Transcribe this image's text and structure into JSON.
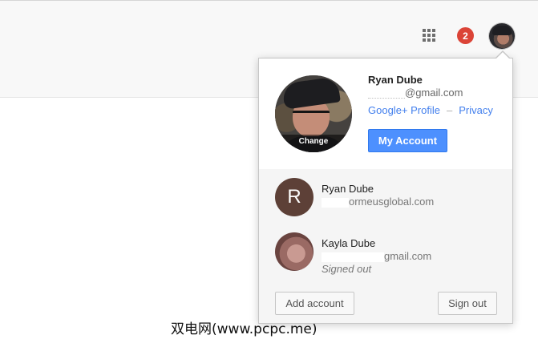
{
  "header": {
    "apps_icon": "apps-grid-icon",
    "notification_count": "2",
    "notification_color": "#db4437"
  },
  "account_menu": {
    "primary": {
      "name": "Ryan Dube",
      "email_suffix": "@gmail.com",
      "change_label": "Change",
      "profile_link": "Google+ Profile",
      "separator": "–",
      "privacy_link": "Privacy",
      "my_account_button": "My Account"
    },
    "accounts": [
      {
        "initial": "R",
        "name": "Ryan Dube",
        "email_suffix": "ormeusglobal.com",
        "status": ""
      },
      {
        "initial": "",
        "name": "Kayla Dube",
        "email_suffix": "gmail.com",
        "status": "Signed out"
      }
    ],
    "footer": {
      "add_account": "Add account",
      "sign_out": "Sign out"
    }
  },
  "colors": {
    "link": "#427fed",
    "primary_button": "#4d90fe",
    "letter_avatar": "#5d4037"
  },
  "watermark": "双电网(www.pcpc.me)"
}
